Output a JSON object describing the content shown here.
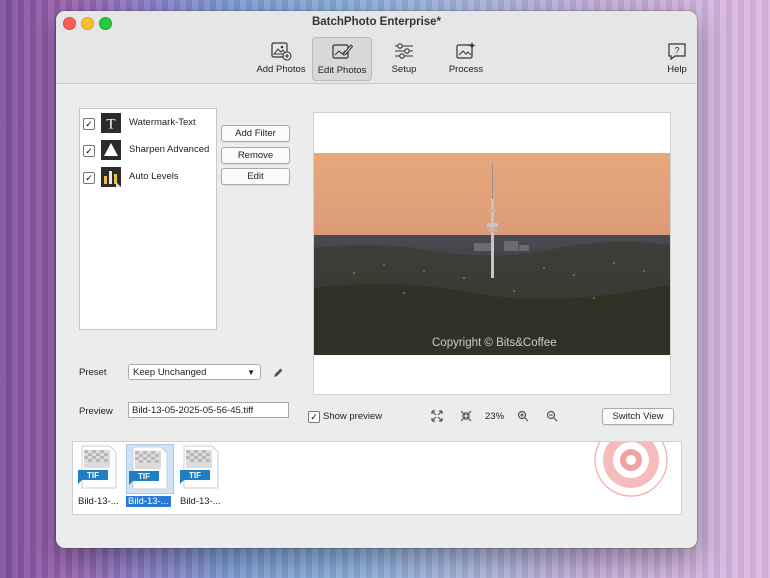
{
  "window": {
    "title": "BatchPhoto Enterprise*"
  },
  "toolbar": {
    "add_photos": "Add Photos",
    "edit_photos": "Edit Photos",
    "setup": "Setup",
    "process": "Process",
    "help": "Help"
  },
  "filters": [
    {
      "label": "Watermark-Text",
      "checked": true,
      "icon": "text-t-icon"
    },
    {
      "label": "Sharpen Advanced",
      "checked": true,
      "icon": "triangle-icon"
    },
    {
      "label": "Auto Levels",
      "checked": true,
      "icon": "levels-bars-icon"
    }
  ],
  "filter_buttons": {
    "add": "Add Filter",
    "remove": "Remove",
    "edit": "Edit"
  },
  "preset": {
    "label": "Preset",
    "value": "Keep Unchanged"
  },
  "preview_field": {
    "label": "Preview",
    "value": "Bild-13-05-2025-05-56-45.tiff"
  },
  "show_preview": {
    "label": "Show preview",
    "checked": true
  },
  "zoom": {
    "level": "23%"
  },
  "switch_view": "Switch View",
  "watermark": {
    "text": "Copyright © Bits&Coffee"
  },
  "thumbnails": [
    {
      "label": "Bild-13-...",
      "badge": "TIF",
      "selected": false
    },
    {
      "label": "Bild-13-...",
      "badge": "TIF",
      "selected": true
    },
    {
      "label": "Bild-13-...",
      "badge": "TIF",
      "selected": false
    }
  ],
  "colors": {
    "selection": "#2a7ad8",
    "sky": "#e8a87c",
    "tif_badge": "#1f7fc4"
  }
}
